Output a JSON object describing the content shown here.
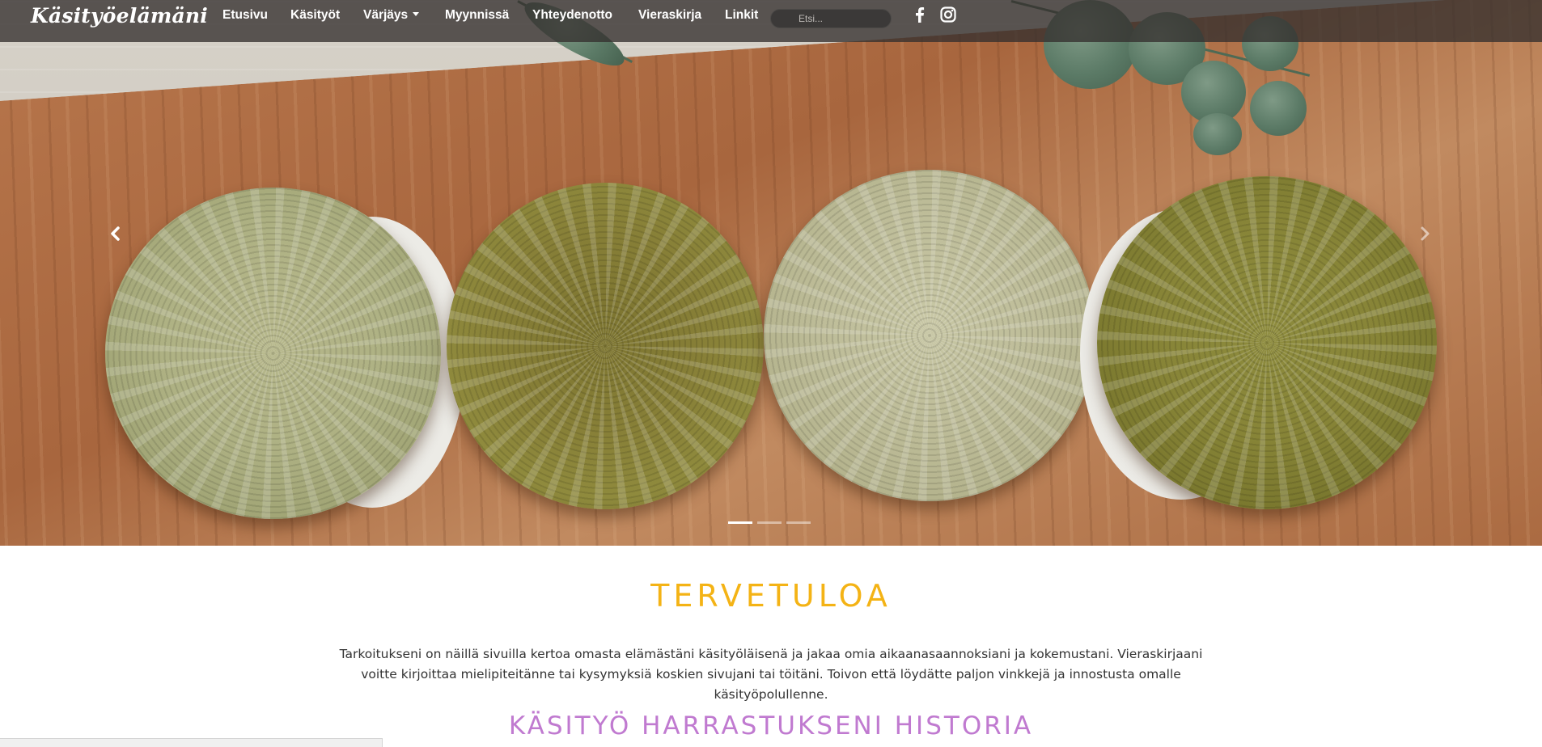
{
  "brand": "Käsityöelämäni",
  "nav": {
    "items": [
      {
        "label": "Etusivu"
      },
      {
        "label": "Käsityöt"
      },
      {
        "label": "Värjäys",
        "dropdown": true
      },
      {
        "label": "Myynnissä"
      },
      {
        "label": "Yhteydenotto"
      },
      {
        "label": "Vieraskirja"
      },
      {
        "label": "Linkit"
      }
    ],
    "search_placeholder": "Etsi...",
    "social": [
      "facebook-icon",
      "instagram-icon"
    ]
  },
  "carousel": {
    "slide_count": 3,
    "active_slide": 1,
    "prev_icon": "chevron-left-icon",
    "next_icon": "chevron-right-icon"
  },
  "content": {
    "welcome_title": "TERVETULOA",
    "intro_text": "Tarkoitukseni on näillä sivuilla kertoa omasta elämästäni käsityöläisenä ja jakaa omia aikaanasaannoksiani ja kokemustani. Vieraskirjaani voitte kirjoittaa mielipiteitänne tai kysymyksiä koskien sivujani tai töitäni. Toivon että löydätte paljon vinkkejä ja innostusta omalle käsityöpolullenne.",
    "history_title": "KÄSITYÖ HARRASTUKSENI HISTORIA"
  },
  "colors": {
    "welcome": "#f4b315",
    "history": "#c07ad0",
    "navbar": "#34302e"
  }
}
